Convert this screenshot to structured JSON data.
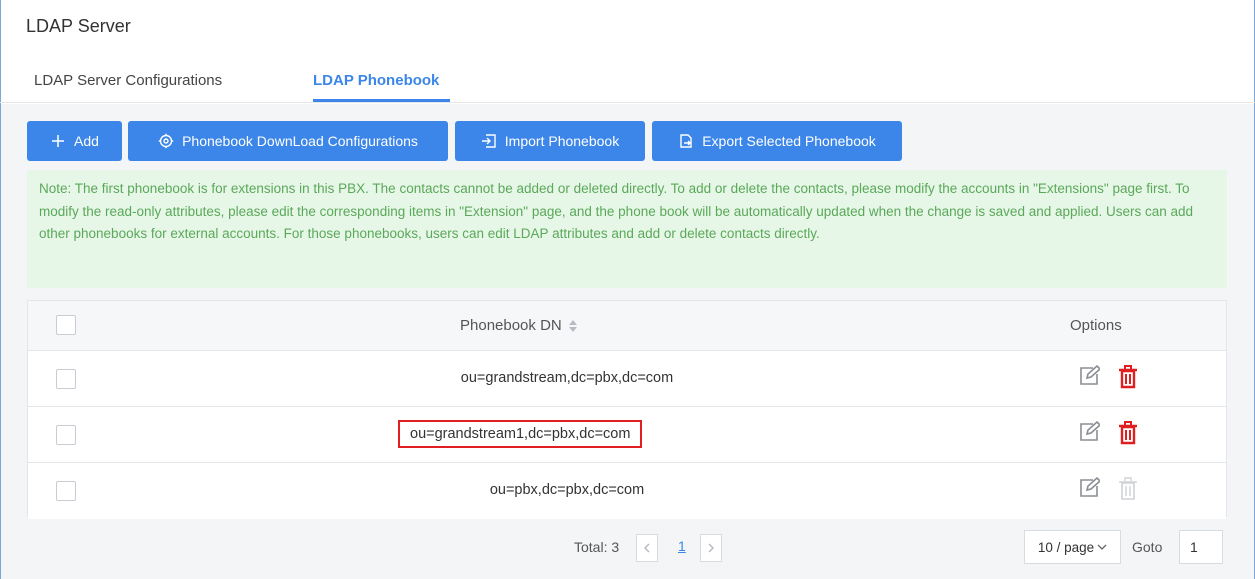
{
  "page": {
    "title": "LDAP Server"
  },
  "tabs": [
    {
      "label": "LDAP Server Configurations",
      "active": false
    },
    {
      "label": "LDAP Phonebook",
      "active": true
    }
  ],
  "toolbar": {
    "add_label": "Add",
    "download_label": "Phonebook DownLoad Configurations",
    "import_label": "Import Phonebook",
    "export_label": "Export Selected Phonebook"
  },
  "note": "Note: The first phonebook is for extensions in this PBX. The contacts cannot be added or deleted directly. To add or delete the contacts, please modify the accounts in \"Extensions\" page first. To modify the read-only attributes, please edit the corresponding items in \"Extension\" page, and the phone book will be automatically updated when the change is saved and applied. Users can add other phonebooks for external accounts. For those phonebooks, users can edit LDAP attributes and add or delete contacts directly.",
  "table": {
    "columns": {
      "dn": "Phonebook DN",
      "options": "Options"
    },
    "rows": [
      {
        "dn": "ou=grandstream,dc=pbx,dc=com",
        "delete_enabled": true,
        "highlighted": false
      },
      {
        "dn": "ou=grandstream1,dc=pbx,dc=com",
        "delete_enabled": true,
        "highlighted": true
      },
      {
        "dn": "ou=pbx,dc=pbx,dc=com",
        "delete_enabled": false,
        "highlighted": false
      }
    ]
  },
  "pagination": {
    "total_label": "Total: 3",
    "current_page": "1",
    "per_page": "10 / page",
    "goto_label": "Goto",
    "goto_value": "1"
  },
  "colors": {
    "accent": "#3b86e8",
    "note_bg": "#e7f7e7",
    "note_text": "#5aa85a",
    "delete_red": "#e02020",
    "delete_disabled": "#cfd2d6",
    "highlight_border": "#e02020"
  },
  "icons": {
    "add": "plus-icon",
    "download": "gear-icon",
    "import": "import-icon",
    "export": "export-icon",
    "sort": "sort-icon",
    "edit": "edit-icon",
    "delete": "trash-icon"
  }
}
